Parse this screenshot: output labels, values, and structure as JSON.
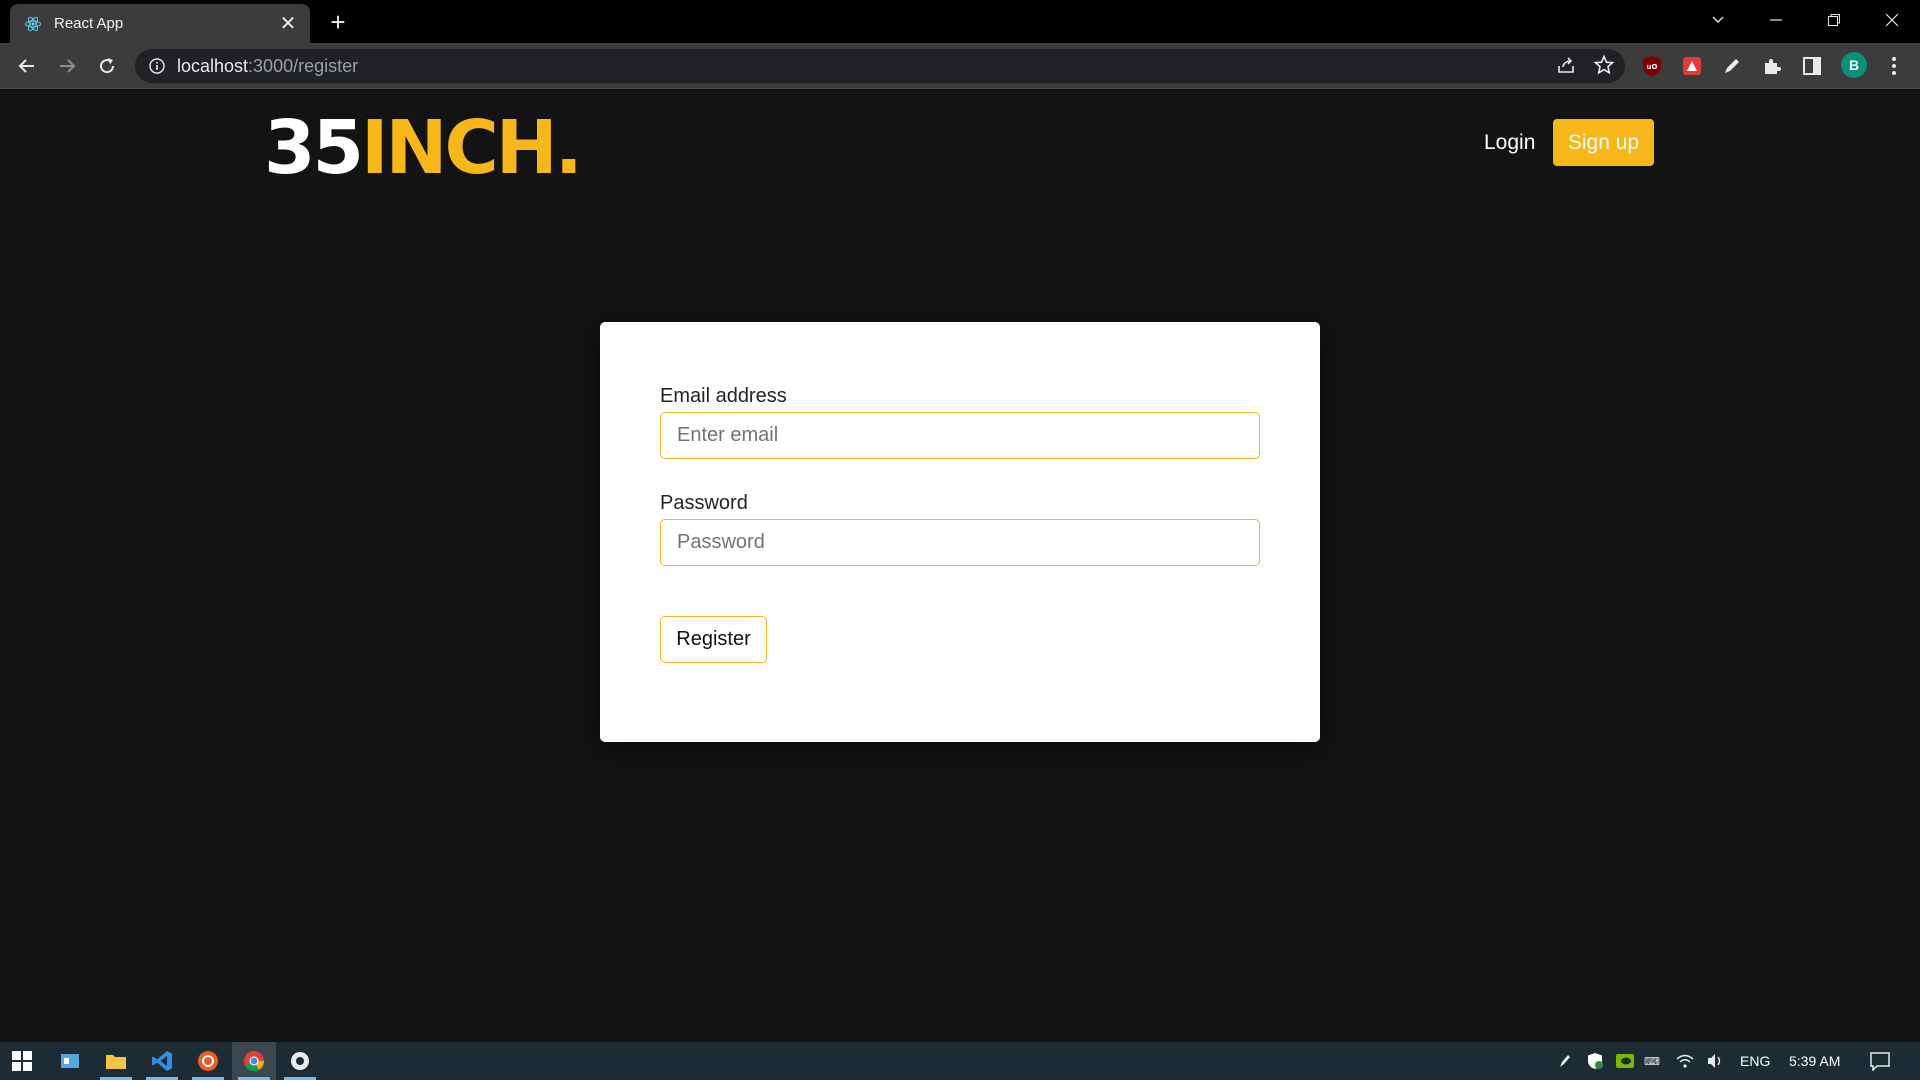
{
  "browser": {
    "tab_title": "React App",
    "url_host": "localhost",
    "url_path": ":3000/register",
    "profile_initial": "B",
    "icons": [
      "react-favicon",
      "close-icon",
      "plus-icon",
      "chevron-down-icon",
      "minimize-icon",
      "restore-icon",
      "window-close-icon",
      "back-icon",
      "forward-icon",
      "reload-icon",
      "info-icon",
      "share-icon",
      "star-icon",
      "ublock-icon",
      "extension-red-icon",
      "pen-icon",
      "puzzle-icon",
      "side-panel-icon",
      "kebab-menu-icon"
    ]
  },
  "header": {
    "logo_part1": "35",
    "logo_part2": "INCH",
    "logo_dot": ".",
    "login_label": "Login",
    "signup_label": "Sign up"
  },
  "form": {
    "email_label": "Email address",
    "email_placeholder": "Enter email",
    "password_label": "Password",
    "password_placeholder": "Password",
    "register_label": "Register"
  },
  "taskbar": {
    "language": "ENG",
    "time": "5:39 AM"
  },
  "colors": {
    "accent": "#f7b71b",
    "page_bg": "#131313",
    "card_bg": "#ffffff"
  }
}
